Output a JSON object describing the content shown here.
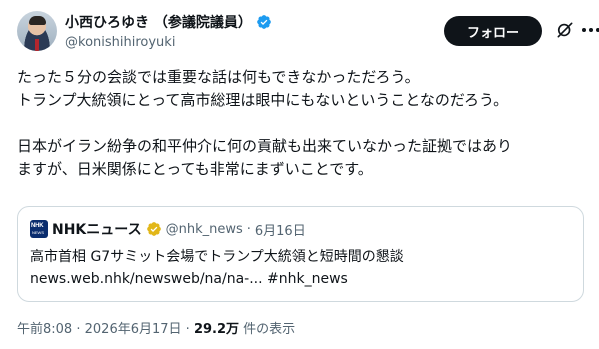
{
  "author": {
    "display_name": "小西ひろゆき （参議院議員）",
    "handle": "@konishihiroyuki"
  },
  "actions": {
    "follow_label": "フォロー"
  },
  "post": {
    "lines": [
      "たった５分の会談では重要な話は何もできなかっただろう。",
      "トランプ大統領にとって高市総理は眼中にもないということなのだろう。",
      "",
      "日本がイラン紛争の和平仲介に何の貢献も出来ていなかった証拠ではあり",
      "ますが、日米関係にとっても非常にまずいことです。"
    ]
  },
  "quote": {
    "source_name": "NHKニュース",
    "logo_text": "NHK",
    "logo_subtext": "NEWS",
    "handle": "@nhk_news",
    "separator": "·",
    "date": "6月16日",
    "title": "高市首相 G7サミット会場でトランプ大統領と短時間の懇談",
    "link": "news.web.nhk/newsweb/na/na-... #nhk_news"
  },
  "meta": {
    "time": "午前8:08",
    "separator": "·",
    "date": "2026年6月17日",
    "separator2": "·",
    "views": "29.2万",
    "views_suffix": "件の表示"
  },
  "icons": {
    "verified": "verified-badge-icon",
    "grok": "grok-icon",
    "more": "more-horizontal-icon",
    "quote_gold": "gold-check-icon"
  },
  "colors": {
    "text": "#0f1419",
    "secondary": "#536471",
    "verified_blue": "#1d9bf0",
    "gold": "#e2b719",
    "follow_bg": "#0f1419",
    "border": "#cfd9de"
  }
}
